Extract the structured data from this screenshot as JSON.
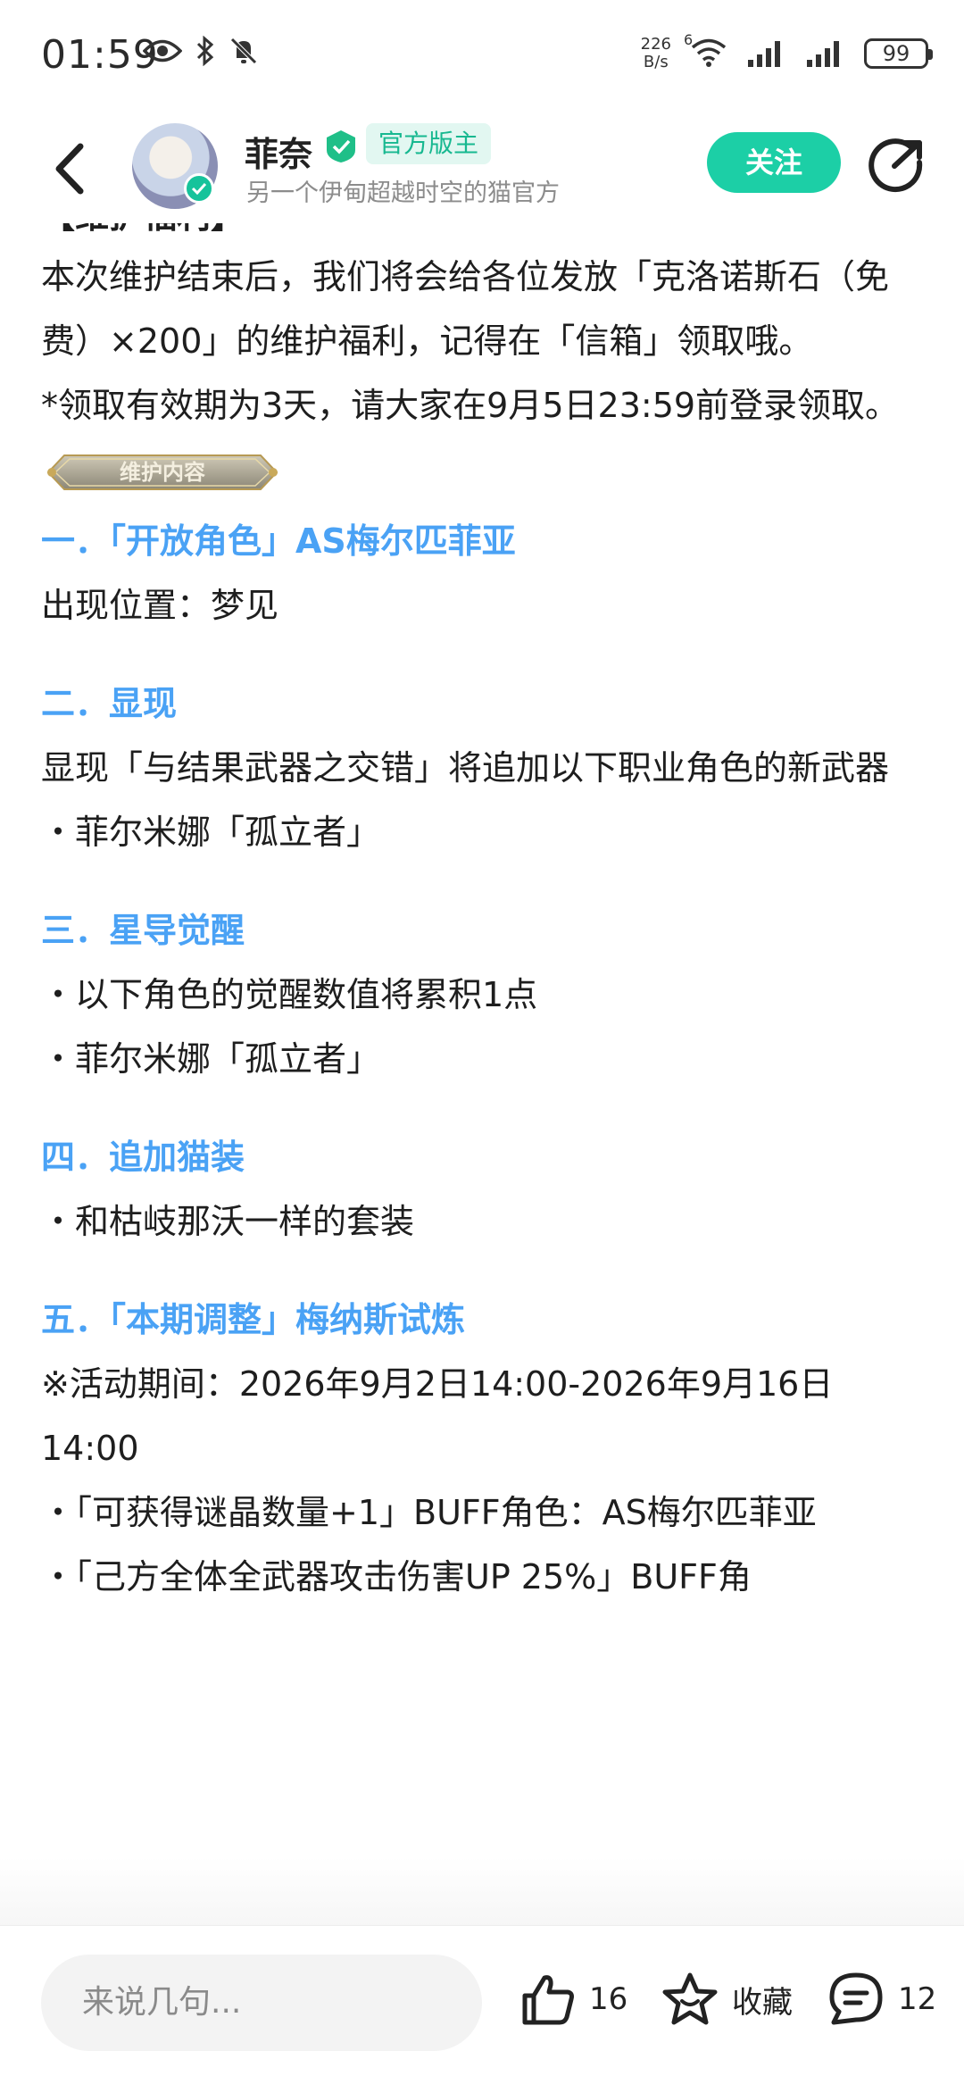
{
  "status_bar": {
    "time": "01:59",
    "net_speed_value": "226",
    "net_speed_unit": "B/s",
    "wifi_label": "6",
    "battery": "99"
  },
  "header": {
    "username": "菲奈",
    "role_badge": "官方版主",
    "subtitle": "另一个伊甸超越时空的猫官方",
    "follow_label": "关注"
  },
  "post": {
    "cut_heading": "【维护福利】",
    "welfare_text": "本次维护结束后，我们将会给各位发放「克洛诺斯石（免费）×200」的维护福利，记得在「信箱」领取哦。",
    "welfare_note": "*领取有效期为3天，请大家在9月5日23:59前登录领取。",
    "banner_label": "维护内容",
    "sections": [
      {
        "heading": "一．「开放角色」AS梅尔匹菲亚",
        "lines": [
          "出现位置：梦见"
        ]
      },
      {
        "heading": "二．显现",
        "lines": [
          "显现「与结果武器之交错」将追加以下职业角色的新武器",
          "・菲尔米娜「孤立者」"
        ]
      },
      {
        "heading": "三．星导觉醒",
        "lines": [
          "・以下角色的觉醒数值将累积1点",
          "・菲尔米娜「孤立者」"
        ]
      },
      {
        "heading": "四．追加猫装",
        "lines": [
          "・和枯岐那沃一样的套装"
        ]
      },
      {
        "heading": "五．「本期调整」梅纳斯试炼",
        "lines": [
          "※活动期间：2026年9月2日14:00-2026年9月16日14:00",
          "・「可获得谜晶数量+1」BUFF角色：AS梅尔匹菲亚",
          "・「己方全体全武器攻击伤害UP 25%」BUFF角"
        ]
      }
    ]
  },
  "bottom_bar": {
    "comment_placeholder": "来说几句...",
    "like_count": "16",
    "favorite_label": "收藏",
    "comment_count": "12"
  },
  "colors": {
    "accent": "#1ccfa6",
    "heading_blue": "#4aa2f5",
    "badge_bg": "#e2f7f1"
  }
}
